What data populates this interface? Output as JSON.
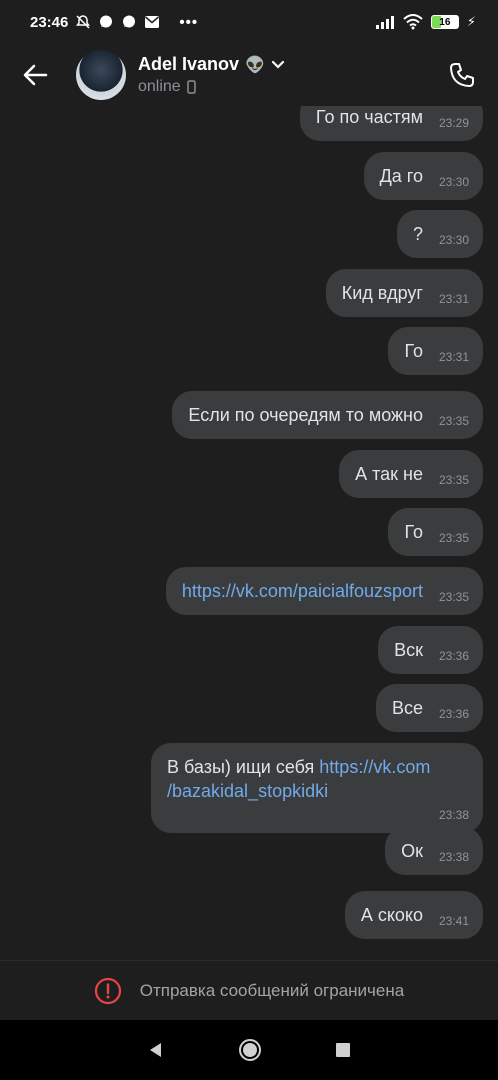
{
  "status_bar": {
    "time": "23:46",
    "battery": "16"
  },
  "header": {
    "name": "Adel Ivanov",
    "badge_emoji": "👽",
    "status": "online"
  },
  "messages": [
    {
      "text": "Го по частям",
      "time": "23:29"
    },
    {
      "text": "Да го",
      "time": "23:30"
    },
    {
      "text": "?",
      "time": "23:30"
    },
    {
      "text": "Кид вдруг",
      "time": "23:31"
    },
    {
      "text": "Го",
      "time": "23:31"
    },
    {
      "text": "Если по очередям то можно",
      "time": "23:35"
    },
    {
      "text": "А так не",
      "time": "23:35"
    },
    {
      "text": "Го",
      "time": "23:35"
    },
    {
      "link": "https://vk.com/paicialfouzsport",
      "time": "23:35"
    },
    {
      "text": "Вск",
      "time": "23:36"
    },
    {
      "text": "Все",
      "time": "23:36"
    },
    {
      "text": "В базы) ищи себя ",
      "link_line1": "https://vk.com",
      "link_line2": "/bazakidal_stopkidki",
      "time": "23:38"
    },
    {
      "text": "Ок",
      "time": "23:38"
    },
    {
      "text": "А скоко",
      "time": "23:41"
    }
  ],
  "restricted_notice": "Отправка сообщений ограничена",
  "colors": {
    "background": "#1e1e1e",
    "bubble": "#3b3c3e",
    "link": "#71aaeb",
    "warning": "#e64646"
  }
}
